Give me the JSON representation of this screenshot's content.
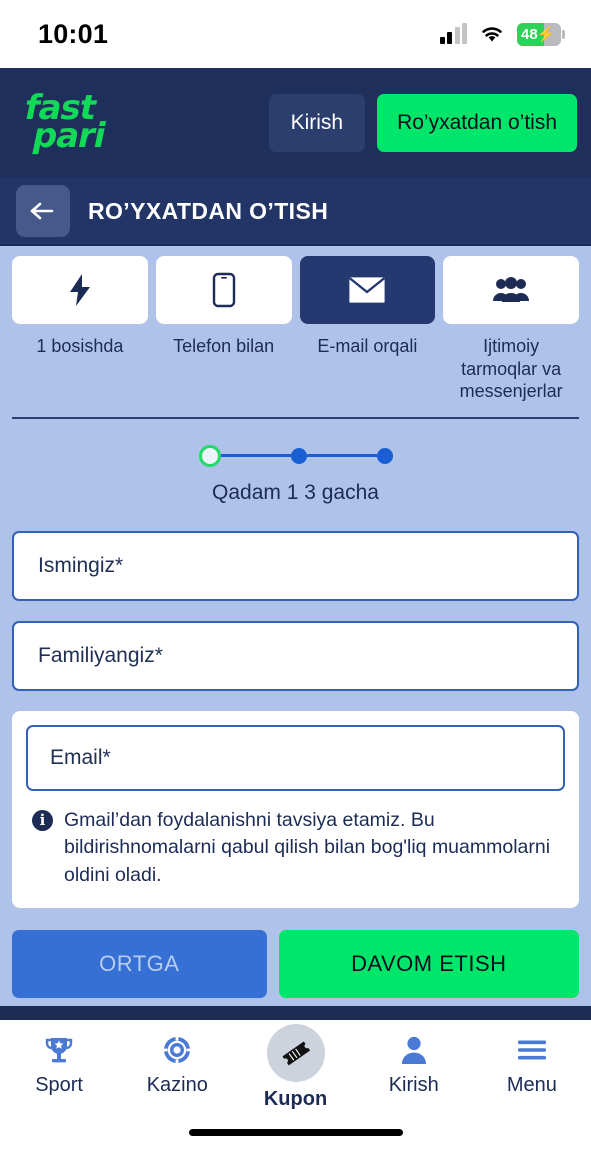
{
  "status_bar": {
    "time": "10:01",
    "battery_percent": "48",
    "charging_glyph": "⚡",
    "icons": [
      "cellular-signal-icon",
      "wifi-icon",
      "battery-icon"
    ]
  },
  "header": {
    "logo_line1": "fast",
    "logo_line2": "pari",
    "login_label": "Kirish",
    "register_label": "Ro’yxatdan o’tish",
    "brand_green": "#00e66b",
    "brand_navy": "#1f2f5c"
  },
  "titlebar": {
    "back_icon": "arrow-left-icon",
    "title": "RO’YXATDAN O’TISH"
  },
  "methods": [
    {
      "label": "1 bosishda",
      "icon": "lightning-bolt-icon",
      "selected": false
    },
    {
      "label": "Telefon bilan",
      "icon": "mobile-phone-icon",
      "selected": false
    },
    {
      "label": "E-mail orqali",
      "icon": "envelope-icon",
      "selected": true
    },
    {
      "label": "Ijtimoiy tarmoqlar va messenjerlar",
      "icon": "people-group-icon",
      "selected": false
    }
  ],
  "stepper": {
    "current_step": 1,
    "total_steps": 3,
    "label": "Qadam 1 3 gacha",
    "active_ring_color": "#22d96a",
    "dot_color": "#1a5ed6"
  },
  "form": {
    "first_name": {
      "placeholder": "Ismingiz*",
      "value": ""
    },
    "last_name": {
      "placeholder": "Familiyangiz*",
      "value": ""
    },
    "email": {
      "placeholder": "Email*",
      "value": ""
    },
    "hint_icon": "info-icon",
    "hint_symbol": "i",
    "hint_text": "Gmail’dan foydalanishni tavsiya etamiz. Bu bildirishnomalarni qabul qilish bilan bog'liq muammolarni oldini oladi."
  },
  "actions": {
    "back_label": "ORTGA",
    "continue_label": "DAVOM ETISH",
    "back_color": "#3670d4",
    "continue_color": "#00e66b"
  },
  "bottom_nav": [
    {
      "label": "Sport",
      "icon": "trophy-icon",
      "active": false
    },
    {
      "label": "Kazino",
      "icon": "casino-chip-icon",
      "active": false
    },
    {
      "label": "Kupon",
      "icon": "ticket-icon",
      "active": true
    },
    {
      "label": "Kirish",
      "icon": "person-icon",
      "active": false
    },
    {
      "label": "Menu",
      "icon": "hamburger-menu-icon",
      "active": false
    }
  ]
}
